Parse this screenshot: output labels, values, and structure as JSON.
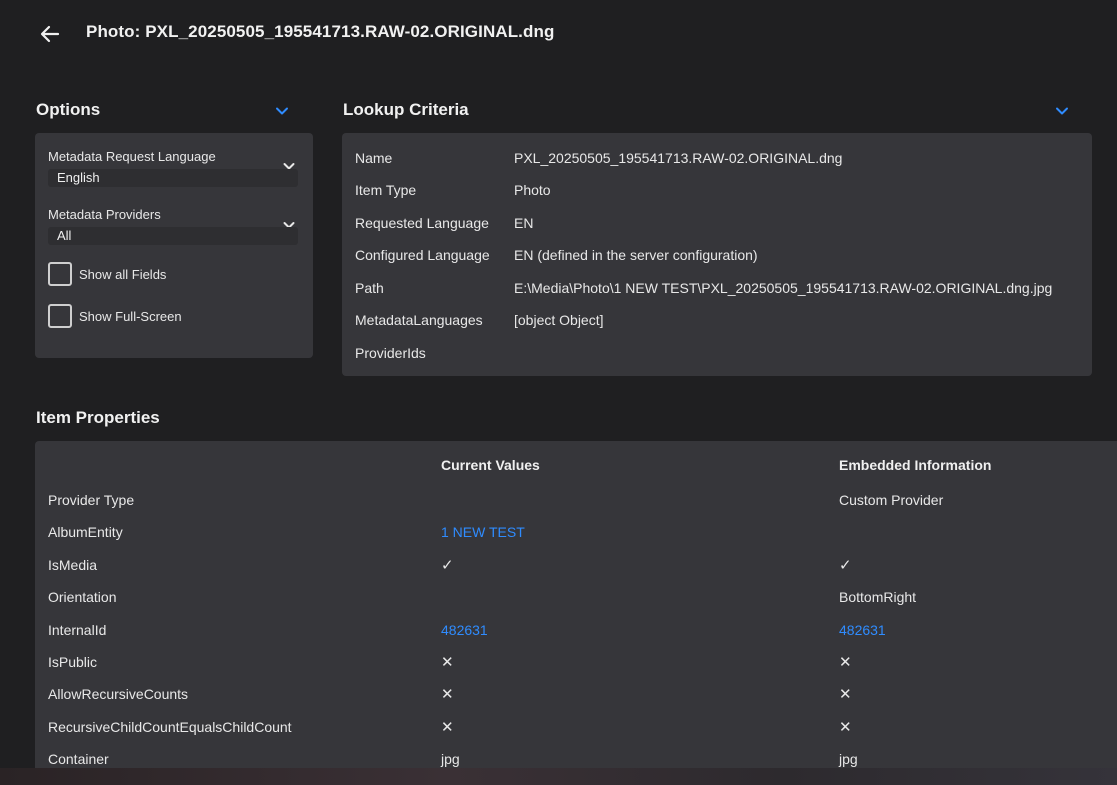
{
  "header": {
    "title": "Photo: PXL_20250505_195541713.RAW-02.ORIGINAL.dng",
    "back_icon": "arrow-left-icon"
  },
  "options": {
    "title": "Options",
    "language_label": "Metadata Request Language",
    "language_value": "English",
    "providers_label": "Metadata Providers",
    "providers_value": "All",
    "show_all_fields": "Show all Fields",
    "show_full_screen": "Show Full-Screen"
  },
  "lookup": {
    "title": "Lookup Criteria",
    "rows": [
      {
        "key": "Name",
        "value": "PXL_20250505_195541713.RAW-02.ORIGINAL.dng"
      },
      {
        "key": "Item Type",
        "value": "Photo"
      },
      {
        "key": "Requested Language",
        "value": "EN"
      },
      {
        "key": "Configured Language",
        "value": "EN (defined in the server configuration)"
      },
      {
        "key": "Path",
        "value": "E:\\Media\\Photo\\1 NEW TEST\\PXL_20250505_195541713.RAW-02.ORIGINAL.dng.jpg"
      },
      {
        "key": "MetadataLanguages",
        "value": "[object Object]"
      },
      {
        "key": "ProviderIds",
        "value": ""
      }
    ]
  },
  "properties": {
    "title": "Item Properties",
    "col_current": "Current Values",
    "col_embedded": "Embedded Information",
    "rows": [
      {
        "name": "Provider Type",
        "current": "",
        "embedded": "Custom Provider"
      },
      {
        "name": "AlbumEntity",
        "current": "1 NEW TEST",
        "embedded": ""
      },
      {
        "name": "IsMedia",
        "current": "✓",
        "embedded": "✓"
      },
      {
        "name": "Orientation",
        "current": "",
        "embedded": "BottomRight"
      },
      {
        "name": "InternalId",
        "current": "482631",
        "embedded": "482631"
      },
      {
        "name": "IsPublic",
        "current": "✕",
        "embedded": "✕"
      },
      {
        "name": "AllowRecursiveCounts",
        "current": "✕",
        "embedded": "✕"
      },
      {
        "name": "RecursiveChildCountEqualsChildCount",
        "current": "✕",
        "embedded": "✕"
      },
      {
        "name": "Container",
        "current": "jpg",
        "embedded": "jpg"
      }
    ]
  },
  "colors": {
    "accent": "#2f8cff",
    "background": "#1f1f21",
    "card": "#36363a"
  }
}
